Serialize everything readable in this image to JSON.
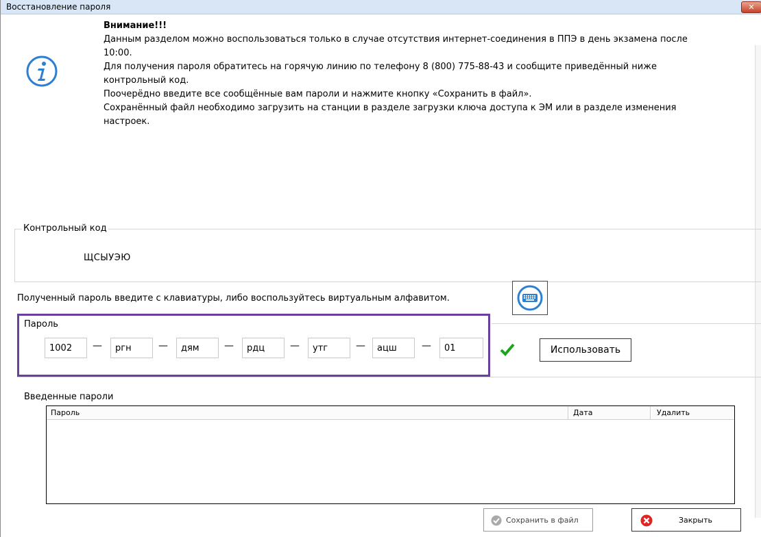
{
  "window": {
    "title": "Восстановление пароля",
    "close_glyph": "✕"
  },
  "warning": {
    "heading": "Внимание!!!",
    "lines": [
      "Данным разделом можно воспользоваться только в случае отсутствия интернет-соединения в ППЭ в день экзамена после",
      "10:00.",
      "Для получения пароля обратитесь на горячую линию по телефону 8 (800) 775-88-43 и сообщите приведённый ниже",
      "контрольный код.",
      "Поочерёдно введите все сообщённые вам пароли и нажмите кнопку «Сохранить в файл».",
      "Сохранённый файл необходимо загрузить на станции в разделе загрузки ключа доступа к ЭМ или в разделе изменения",
      "настроек."
    ]
  },
  "control_code": {
    "legend": "Контрольный код",
    "value": "ЩСЫУЭЮ"
  },
  "hint": "Полученный пароль введите с клавиатуры, либо воспользуйтесь виртуальным алфавитом.",
  "password": {
    "legend": "Пароль",
    "segments": [
      "1002",
      "ргн",
      "дям",
      "рдц",
      "утг",
      "ацш",
      "01"
    ],
    "dash": "—",
    "use_label": "Использовать"
  },
  "entered": {
    "label": "Введенные пароли",
    "columns": [
      "Пароль",
      "Дата",
      "Удалить"
    ]
  },
  "buttons": {
    "save_label": "Сохранить в файл",
    "close_label": "Закрыть"
  },
  "icons": {
    "info": "info-icon",
    "keyboard": "keyboard-icon",
    "check": "checkmark-icon",
    "save": "check-circle-icon",
    "close": "close-circle-icon"
  },
  "colors": {
    "accent_purple": "#6b3fa0",
    "check_green": "#1fa31f",
    "close_red": "#e02424",
    "info_blue": "#2d7fd3"
  }
}
